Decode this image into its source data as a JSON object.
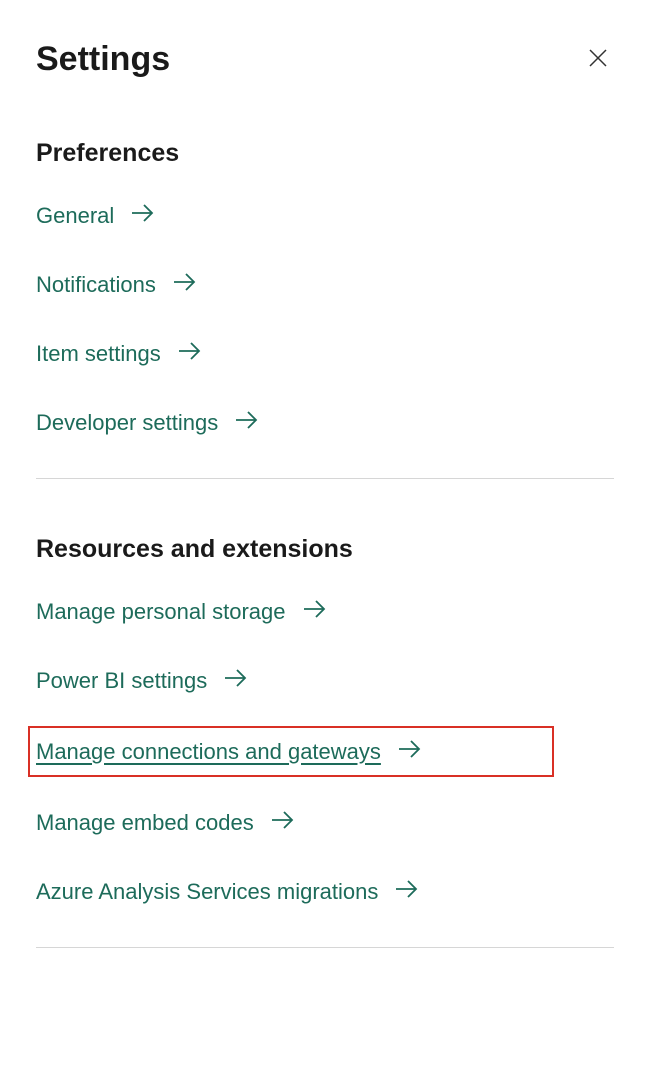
{
  "header": {
    "title": "Settings"
  },
  "sections": [
    {
      "title": "Preferences",
      "items": [
        {
          "label": "General"
        },
        {
          "label": "Notifications"
        },
        {
          "label": "Item settings"
        },
        {
          "label": "Developer settings"
        }
      ]
    },
    {
      "title": "Resources and extensions",
      "items": [
        {
          "label": "Manage personal storage"
        },
        {
          "label": "Power BI settings"
        },
        {
          "label": "Manage connections and gateways",
          "highlighted": true
        },
        {
          "label": "Manage embed codes"
        },
        {
          "label": "Azure Analysis Services migrations"
        }
      ]
    }
  ]
}
